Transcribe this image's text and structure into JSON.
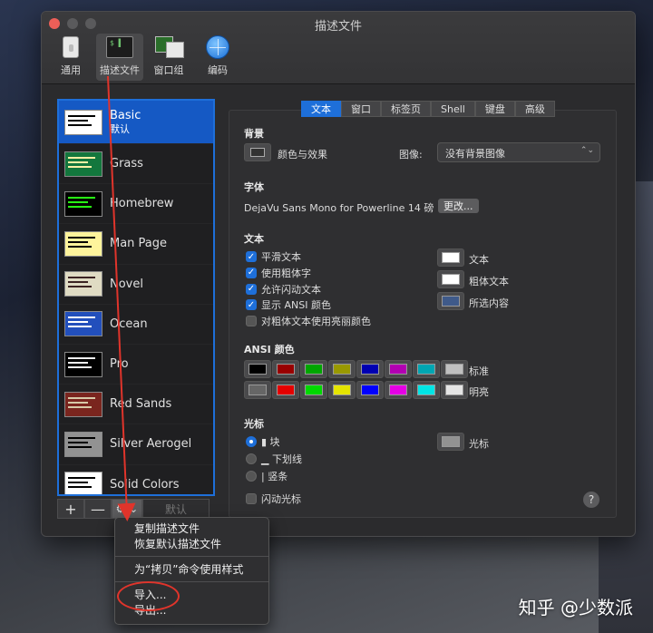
{
  "window": {
    "title": "描述文件"
  },
  "toolbar": [
    {
      "label": "通用",
      "icon": "general-switch-icon"
    },
    {
      "label": "描述文件",
      "icon": "terminal-profile-icon",
      "active": true
    },
    {
      "label": "窗口组",
      "icon": "window-group-icon"
    },
    {
      "label": "编码",
      "icon": "globe-icon"
    }
  ],
  "profiles": [
    {
      "name": "Basic",
      "sub": "默认",
      "bg": "#ffffff",
      "fg": "#000000",
      "selected": true
    },
    {
      "name": "Grass",
      "sub": "",
      "bg": "#13773d",
      "fg": "#fff0a5"
    },
    {
      "name": "Homebrew",
      "sub": "",
      "bg": "#000000",
      "fg": "#28fe14"
    },
    {
      "name": "Man Page",
      "sub": "",
      "bg": "#fef49c",
      "fg": "#000000"
    },
    {
      "name": "Novel",
      "sub": "",
      "bg": "#dfdbc3",
      "fg": "#3b2322"
    },
    {
      "name": "Ocean",
      "sub": "",
      "bg": "#224fbc",
      "fg": "#ffffff"
    },
    {
      "name": "Pro",
      "sub": "",
      "bg": "#000000",
      "fg": "#f2f2f2"
    },
    {
      "name": "Red Sands",
      "sub": "",
      "bg": "#7a251e",
      "fg": "#d7c9a7"
    },
    {
      "name": "Silver Aerogel",
      "sub": "",
      "bg": "#929292",
      "fg": "#000000"
    },
    {
      "name": "Solid Colors",
      "sub": "",
      "bg": "#ffffff",
      "fg": "#000000"
    }
  ],
  "list_buttons": {
    "add": "+",
    "remove": "—",
    "gear": "⚙ ⌄",
    "default": "默认"
  },
  "tabs": [
    "文本",
    "窗口",
    "标签页",
    "Shell",
    "键盘",
    "高级"
  ],
  "background": {
    "title": "背景",
    "color_effect_label": "颜色与效果",
    "image_label": "图像:",
    "image_value": "没有背景图像"
  },
  "font": {
    "title": "字体",
    "value": "DejaVu Sans Mono for Powerline 14 磅",
    "change_button": "更改..."
  },
  "text": {
    "title": "文本",
    "options": [
      {
        "label": "平滑文本",
        "checked": true
      },
      {
        "label": "使用粗体字",
        "checked": true
      },
      {
        "label": "允许闪动文本",
        "checked": true
      },
      {
        "label": "显示 ANSI 颜色",
        "checked": true
      },
      {
        "label": "对粗体文本使用亮丽颜色",
        "checked": false
      }
    ],
    "colors": [
      {
        "label": "文本",
        "color": "#ffffff"
      },
      {
        "label": "粗体文本",
        "color": "#ffffff"
      },
      {
        "label": "所选内容",
        "color": "#3f5a8a"
      }
    ]
  },
  "ansi": {
    "title": "ANSI 颜色",
    "normal_label": "标准",
    "bright_label": "明亮",
    "normal": [
      "#000000",
      "#990000",
      "#00a600",
      "#999900",
      "#0000b2",
      "#b200b2",
      "#00a6b2",
      "#bfbfbf"
    ],
    "bright": [
      "#666666",
      "#e50000",
      "#00d900",
      "#e5e500",
      "#0000ff",
      "#e500e5",
      "#00e5e5",
      "#e5e5e5"
    ]
  },
  "cursor": {
    "title": "光标",
    "options": [
      {
        "label": "▮ 块",
        "selected": true
      },
      {
        "label": "▁ 下划线",
        "selected": false
      },
      {
        "label": "| 竖条",
        "selected": false
      }
    ],
    "blink_label": "闪动光标",
    "cursor_label": "光标",
    "cursor_color": "#929292"
  },
  "help": "?",
  "menu": {
    "items": [
      "复制描述文件",
      "恢复默认描述文件"
    ],
    "copy_style": "为“拷贝”命令使用样式",
    "import": "导入...",
    "export": "导出..."
  },
  "watermark": "知乎 @少数派",
  "colors": {
    "accent": "#1e6fd9",
    "annotation_red": "#e0342b"
  }
}
